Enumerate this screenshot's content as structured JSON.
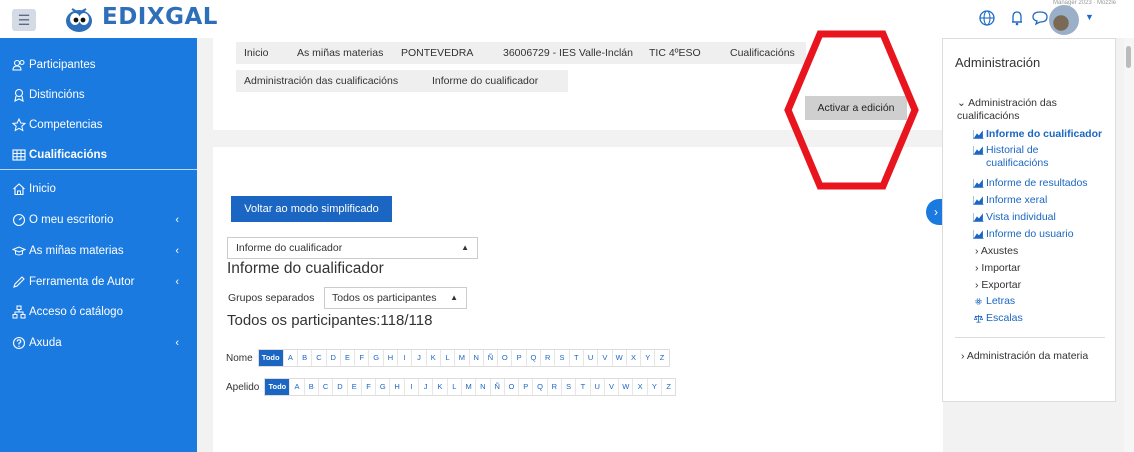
{
  "header": {
    "logo_text": "EDIXGAL",
    "tiny_text": "Manager 2023 · Mozzle",
    "icons": [
      "menu-icon",
      "globe-icon",
      "bell-icon",
      "chat-icon",
      "caret-down-icon"
    ]
  },
  "sidebar": {
    "items": [
      {
        "label": "Participantes",
        "icon": "people-icon"
      },
      {
        "label": "Distincións",
        "icon": "badge-icon"
      },
      {
        "label": "Competencias",
        "icon": "star-icon"
      },
      {
        "label": "Cualificacións",
        "icon": "table-icon"
      },
      {
        "label": "Inicio",
        "icon": "home-icon"
      },
      {
        "label": "O meu escritorio",
        "icon": "dashboard-icon"
      },
      {
        "label": "As miñas materias",
        "icon": "graduation-cap-icon"
      },
      {
        "label": "Ferramenta de Autor",
        "icon": "pencil-icon"
      },
      {
        "label": "Acceso ó catálogo",
        "icon": "sitemap-icon"
      },
      {
        "label": "Axuda",
        "icon": "help-icon"
      }
    ],
    "chevron": "‹"
  },
  "breadcrumb": {
    "row1": [
      "Inicio",
      "As miñas materias",
      "PONTEVEDRA",
      "36006729 - IES Valle-Inclán",
      "TIC 4ºESO",
      "Cualificacións"
    ],
    "row2": [
      "Administración das cualificacións",
      "Informe do cualificador"
    ]
  },
  "edit_button": "Activar a edición",
  "main": {
    "simplified_button": "Voltar ao modo simplificado",
    "report_select": "Informe do cualificador",
    "heading": "Informe do cualificador",
    "groups_label": "Grupos separados",
    "groups_select": "Todos os participantes",
    "participants_heading": "Todos os participantes:118/118",
    "name_filter_label": "Nome",
    "surname_filter_label": "Apelido",
    "filter_all": "Todo",
    "letters": [
      "A",
      "B",
      "C",
      "D",
      "E",
      "F",
      "G",
      "H",
      "I",
      "J",
      "K",
      "L",
      "M",
      "N",
      "Ñ",
      "O",
      "P",
      "Q",
      "R",
      "S",
      "T",
      "U",
      "V",
      "W",
      "X",
      "Y",
      "Z"
    ]
  },
  "admin": {
    "title": "Administración",
    "section": "Administración das cualificacións",
    "links": [
      {
        "label": "Informe do cualificador",
        "active": true
      },
      {
        "label": "Historial de cualificacións"
      },
      {
        "label": "Informe de resultados"
      },
      {
        "label": "Informe xeral"
      },
      {
        "label": "Vista individual"
      },
      {
        "label": "Informe do usuario"
      }
    ],
    "subsections": [
      "Axustes",
      "Importar",
      "Exportar"
    ],
    "letters_link": "Letras",
    "scales_link": "Escalas",
    "course_admin": "Administración da materia"
  },
  "colors": {
    "primary": "#1a7ae0",
    "link": "#1a66c2",
    "annotation": "#e8141e"
  }
}
